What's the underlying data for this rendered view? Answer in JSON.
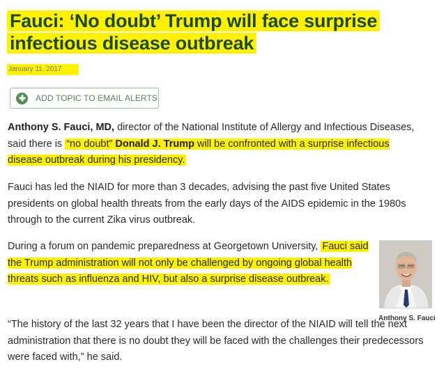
{
  "article": {
    "title_line1": "Fauci: ‘No doubt’ Trump will face surprise",
    "title_line2": "infectious disease outbreak",
    "date": "January 11, 2017",
    "alert_button_label": "ADD TOPIC TO EMAIL ALERTS",
    "p1": {
      "name": "Anthony S. Fauci, MD,",
      "text1": " director of the National Institute of Allergy and Infectious Diseases, said there is ",
      "hl_a": "“no doubt” ",
      "hl_name": "Donald J. Trump",
      "hl_b": " will be confronted with a surprise infectious disease outbreak during his presidency."
    },
    "p2": "Fauci has led the NIAID for more than 3 decades, advising the past five United States presidents on global health threats from the early days of the AIDS epidemic in the 1980s through to the current Zika virus outbreak.",
    "p3": {
      "text1": "During a forum on pandemic preparedness at Georgetown University, ",
      "hl": "Fauci said the Trump administration will not only be challenged by ongoing global health threats such as influenza and HIV, but also a surprise disease outbreak."
    },
    "p4": "“The history of the last 32 years that I have been the director of the NIAID will tell the next administration that there is no doubt they will be faced with the challenges their predecessors were faced with,” he said.",
    "photo_caption": "Anthony S. Fauci"
  },
  "colors": {
    "highlight": "#fff200",
    "title": "#1f4a1f",
    "button_accent": "#4f8f4f"
  },
  "icons": {
    "alert_button": "plus-circle-icon"
  }
}
